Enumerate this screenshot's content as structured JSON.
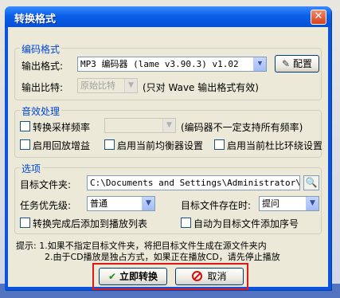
{
  "window": {
    "title": "转换格式",
    "close_glyph": "✕"
  },
  "encoding": {
    "group_title": "编码格式",
    "format_label": "输出格式:",
    "format_value": "MP3 编码器 (lame v3.90.3) v1.02",
    "config_button": "配置",
    "bitrate_label": "输出比特:",
    "bitrate_value": "原始比特",
    "bitrate_note": "(只对 Wave 输出格式有效)"
  },
  "effects": {
    "group_title": "音效处理",
    "convert_rate_label": "转换采样频率",
    "rate_note": "(编码器不一定支持所有频率)",
    "replay_gain": "启用回放增益",
    "equalizer": "启用当前均衡器设置",
    "stereo": "启用当前杜比环绕设置"
  },
  "options": {
    "group_title": "选项",
    "target_folder_label": "目标文件夹:",
    "target_folder_value": "C:\\Documents and Settings\\Administrator\\桌面",
    "priority_label": "任务优先级:",
    "priority_value": "普通",
    "exists_label": "目标文件存在时:",
    "exists_value": "提问",
    "add_playlist": "转换完成后添加到播放列表",
    "add_serial": "自动为目标文件添加序号"
  },
  "tips": {
    "line1": "提示: 1.如果不指定目标文件夹，将把目标文件生成在源文件夹内",
    "line2": "2.由于CD播放是独占方式，如果正在播放CD，请先停止播放"
  },
  "buttons": {
    "convert": "立即转换",
    "cancel": "取消"
  },
  "colors": {
    "titlebar": "#0a5fe8",
    "group_title": "#0046d5",
    "highlight_box": "#e01818"
  }
}
